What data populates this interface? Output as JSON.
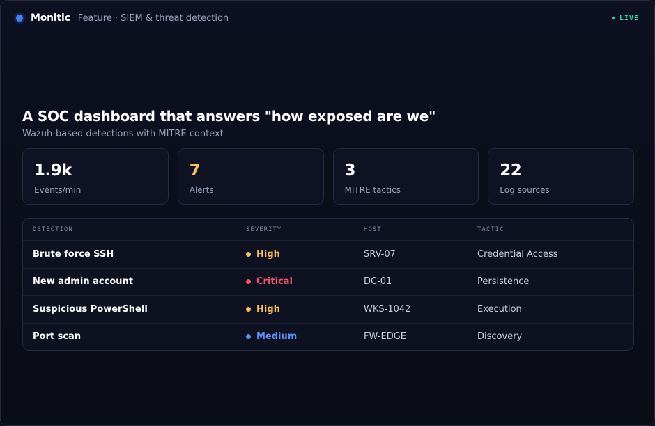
{
  "header": {
    "brand": "Monitic",
    "crumb": "Feature · SIEM & threat detection",
    "live": "LIVE"
  },
  "hero": {
    "title": "A SOC dashboard that answers \"how exposed are we\"",
    "subtitle": "Wazuh-based detections with MITRE context"
  },
  "stats": [
    {
      "value": "1.9k",
      "label": "Events/min"
    },
    {
      "value": "7",
      "label": "Alerts"
    },
    {
      "value": "3",
      "label": "MITRE tactics"
    },
    {
      "value": "22",
      "label": "Log sources"
    }
  ],
  "table": {
    "columns": [
      "DETECTION",
      "SEVERITY",
      "HOST",
      "TACTIC"
    ],
    "rows": [
      {
        "detection": "Brute force SSH",
        "severity": "High",
        "host": "SRV-07",
        "tactic": "Credential Access"
      },
      {
        "detection": "New admin account",
        "severity": "Critical",
        "host": "DC-01",
        "tactic": "Persistence"
      },
      {
        "detection": "Suspicious PowerShell",
        "severity": "High",
        "host": "WKS-1042",
        "tactic": "Execution"
      },
      {
        "detection": "Port scan",
        "severity": "Medium",
        "host": "FW-EDGE",
        "tactic": "Discovery"
      }
    ]
  },
  "colors": {
    "accent": "#3b82f6",
    "live": "#34d399",
    "high": "#fbbf5a",
    "critical": "#f0566a",
    "medium": "#5b8ff5"
  }
}
